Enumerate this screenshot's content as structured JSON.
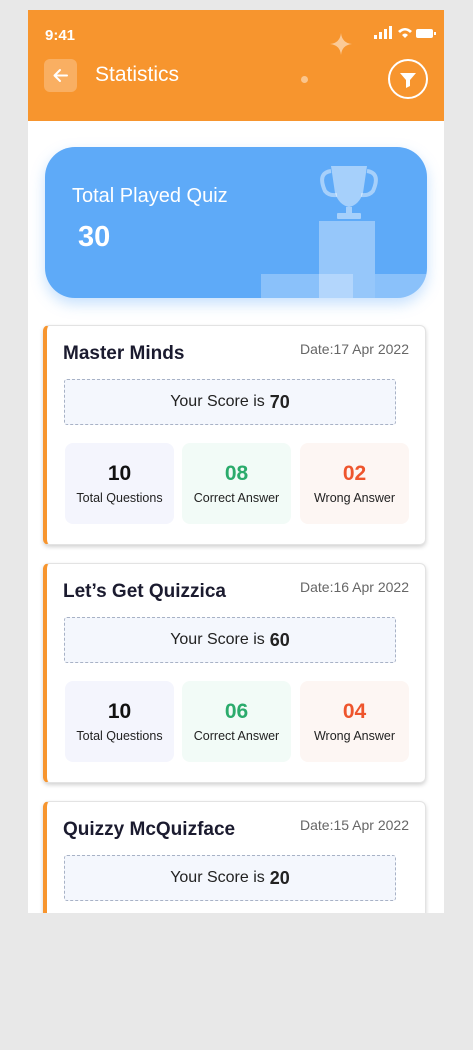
{
  "status_bar": {
    "time": "9:41"
  },
  "header": {
    "title": "Statistics",
    "back_icon": "arrow-left-icon",
    "filter_icon": "filter-icon",
    "accent": "#f7952e"
  },
  "summary": {
    "label": "Total Played Quiz",
    "value": "30",
    "color": "#5eaaf8"
  },
  "stat_labels": {
    "total": "Total Questions",
    "correct": "Correct Answer",
    "wrong": "Wrong Answer"
  },
  "quizzes": [
    {
      "title": "Master Minds",
      "date_prefix": "Date:",
      "date": "17 Apr 2022",
      "score_label": "Your Score is",
      "score": "70",
      "total": "10",
      "correct": "08",
      "wrong": "02"
    },
    {
      "title": "Let’s Get Quizzica",
      "date_prefix": "Date:",
      "date": "16 Apr 2022",
      "score_label": "Your Score is",
      "score": "60",
      "total": "10",
      "correct": "06",
      "wrong": "04"
    },
    {
      "title": "Quizzy McQuizface",
      "date_prefix": "Date:",
      "date": "15 Apr 2022",
      "score_label": "Your Score is",
      "score": "20"
    }
  ]
}
